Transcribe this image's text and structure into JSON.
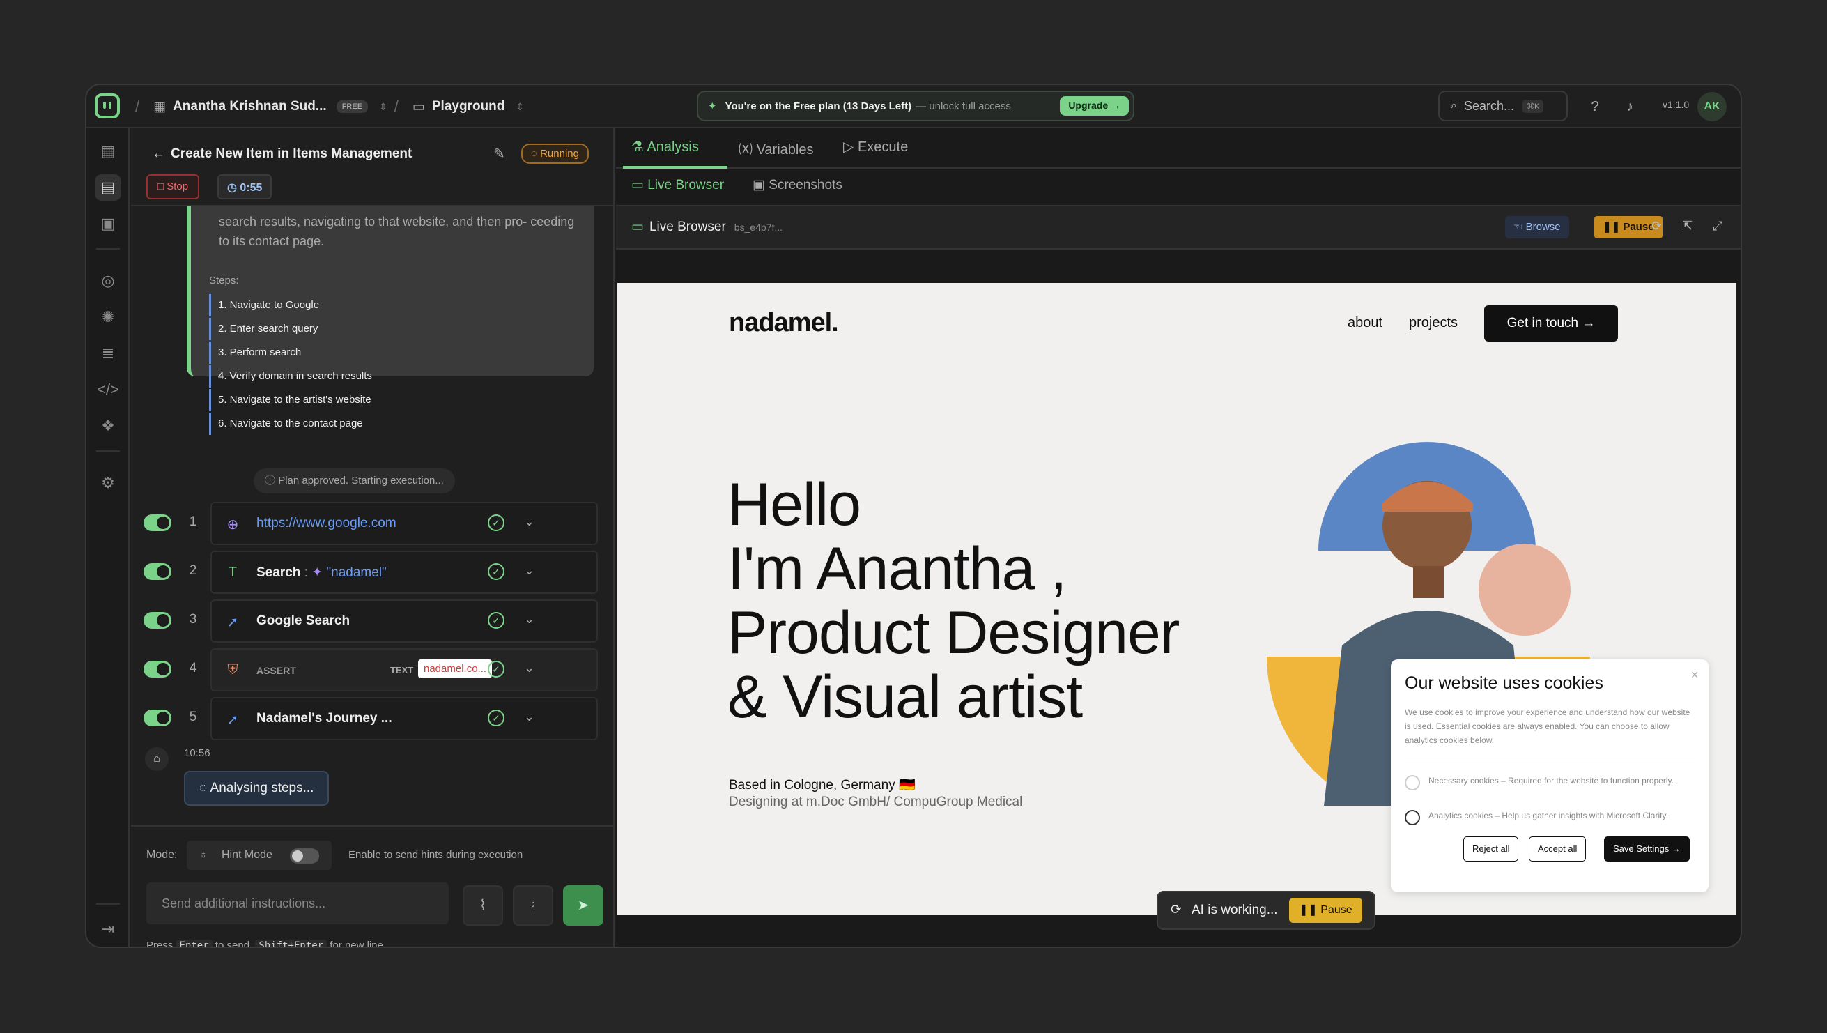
{
  "topbar": {
    "workspace": "Anantha Krishnan Sud...",
    "plan_badge": "FREE",
    "project": "Playground",
    "promo_text": "You're on the Free plan (13 Days Left)",
    "promo_sub": "— unlock full access",
    "upgrade_label": "Upgrade →",
    "search_label": "Search...",
    "search_kbd": "⌘K",
    "version": "v1.1.0",
    "avatar": "AK"
  },
  "task": {
    "title": "Create New Item in Items Management",
    "status": "Running",
    "stop_label": "Stop",
    "timer": "0:55"
  },
  "plan": {
    "text": "search results, navigating to that website, and then pro- ceeding to its contact page.",
    "steps_title": "Steps:",
    "steps": [
      "1. Navigate to Google",
      "2. Enter search query",
      "3. Perform search",
      "4. Verify domain in search results",
      "5. Navigate to the artist's website",
      "6. Navigate to the contact page"
    ],
    "approved": "Plan approved. Starting execution..."
  },
  "actions": [
    {
      "num": "1",
      "label": "https://www.google.com"
    },
    {
      "num": "2",
      "label": "Search",
      "value": "\"nadamel\""
    },
    {
      "num": "3",
      "label": "Google Search"
    },
    {
      "num": "4",
      "label": "ASSERT",
      "type": "TEXT",
      "value": "nadamel.co..."
    },
    {
      "num": "5",
      "label": "Nadamel's Journey ..."
    }
  ],
  "chat": {
    "time": "10:56",
    "analysing": "Analysing steps..."
  },
  "composer": {
    "mode_label": "Mode:",
    "hint_label": "Hint Mode",
    "hint_desc": "Enable to send hints during execution",
    "placeholder": "Send additional instructions...",
    "press": "Press",
    "enter_key": "Enter",
    "to_send": "to send,",
    "shift_key": "Shift+Enter",
    "new_line": "for new line"
  },
  "right": {
    "tabs": [
      "Analysis",
      "Variables",
      "Execute"
    ],
    "subtabs": [
      "Live Browser",
      "Screenshots"
    ],
    "browser_title": "Live Browser",
    "session": "bs_e4b7f...",
    "browse_label": "Browse",
    "pause_label": "Pause"
  },
  "website": {
    "brand": "nadamel.",
    "nav": [
      "about",
      "projects"
    ],
    "cta": "Get in touch →",
    "hero": [
      "Hello",
      "I'm Anantha ,",
      "Product Designer",
      "& Visual artist"
    ],
    "based": "Based in Cologne, Germany 🇩🇪",
    "designing": "Designing at m.Doc GmbH/ CompuGroup Medical",
    "cookie": {
      "title": "Our website uses cookies",
      "desc": "We use cookies to improve your experience and understand how our website is used. Essential cookies are always enabled. You can choose to allow analytics cookies below.",
      "necessary": "Necessary cookies – Required for the website to function properly.",
      "analytics": "Analytics cookies – Help us gather insights with Microsoft Clarity.",
      "reject": "Reject all",
      "accept": "Accept all",
      "save": "Save Settings →"
    }
  },
  "ai_status": {
    "text": "AI is working...",
    "pause": "Pause"
  },
  "colors": {
    "accent": "#7bd389",
    "running": "#f1a543",
    "stop": "#f16a6a",
    "link": "#6a9cf5",
    "pause": "#e0b028"
  }
}
